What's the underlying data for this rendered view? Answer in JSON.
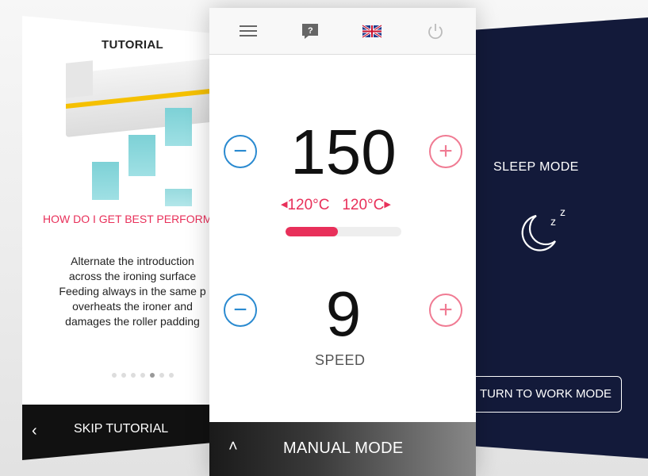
{
  "tutorial": {
    "title": "TUTORIAL",
    "question": "HOW DO I GET BEST PERFORM",
    "body": "Alternate the introduction\nacross the ironing surface\nFeeding always in the same p\noverheats the ironer and\ndamages the roller padding",
    "dots_total": 7,
    "dots_active_index": 4,
    "skip_label": "SKIP TUTORIAL",
    "colors": {
      "question": "#e8305a",
      "bottom_bar": "#111111"
    }
  },
  "main": {
    "icons": [
      "menu-icon",
      "help-icon",
      "uk-flag-icon",
      "power-icon"
    ],
    "temperature": {
      "value": "150",
      "range_min": "120°C",
      "range_max": "120°C",
      "progress_fraction": 0.45
    },
    "speed": {
      "value": "9",
      "label": "SPEED"
    },
    "mode_label": "MANUAL MODE",
    "colors": {
      "minus": "#2a8ad0",
      "plus": "#f07b93",
      "accent": "#e8305a"
    }
  },
  "sleep": {
    "title": "SLEEP MODE",
    "button_label": "TURN TO  WORK MODE",
    "icon": "moon-zzz-icon",
    "colors": {
      "background": "#131a3a"
    }
  }
}
